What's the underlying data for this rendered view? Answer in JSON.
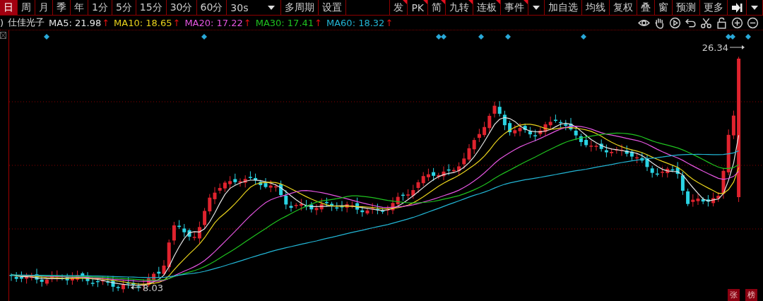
{
  "toolbar": {
    "periods": [
      {
        "label": "日",
        "selected": true
      },
      {
        "label": "周",
        "selected": false
      },
      {
        "label": "月",
        "selected": false
      },
      {
        "label": "季",
        "selected": false
      },
      {
        "label": "年",
        "selected": false
      },
      {
        "label": "1分",
        "selected": false
      },
      {
        "label": "5分",
        "selected": false
      },
      {
        "label": "15分",
        "selected": false
      },
      {
        "label": "30分",
        "selected": false
      },
      {
        "label": "60分",
        "selected": false
      },
      {
        "label": "30s",
        "selected": false,
        "kind": "dropdown"
      },
      {
        "label": "多周期",
        "selected": false
      },
      {
        "label": "设置",
        "selected": false
      }
    ],
    "tools": [
      {
        "label": "发",
        "kind": "flagged"
      },
      {
        "label": "PK",
        "kind": "flagged"
      },
      {
        "label": "简",
        "kind": "flagged"
      },
      {
        "label": "九转",
        "kind": "flagged"
      },
      {
        "label": "连板",
        "kind": "flagged"
      },
      {
        "label": "事件",
        "kind": "flagged"
      },
      {
        "kind": "dropdown"
      },
      {
        "label": "加自选",
        "kind": "plain"
      },
      {
        "label": "均线",
        "kind": "plain"
      },
      {
        "label": "复权",
        "kind": "plain"
      },
      {
        "label": "叠",
        "kind": "plain"
      },
      {
        "label": "窗",
        "kind": "plain"
      },
      {
        "label": "预测",
        "kind": "plain"
      },
      {
        "label": "更多",
        "kind": "plain"
      },
      {
        "kind": "collapse"
      },
      {
        "kind": "dropdown"
      }
    ]
  },
  "legend": {
    "prefix": ")",
    "name": "仕佳光子",
    "averages": [
      {
        "label": "MA5: 21.98",
        "arrow": "↑",
        "color": "#e6e6e6"
      },
      {
        "label": "MA10: 18.65",
        "arrow": "↑",
        "color": "#e8d21c"
      },
      {
        "label": "MA20: 17.22",
        "arrow": "↑",
        "color": "#e455e0"
      },
      {
        "label": "MA30: 17.41",
        "arrow": "↑",
        "color": "#1fc21f"
      },
      {
        "label": "MA60: 18.32",
        "arrow": "↑",
        "color": "#22b5d4"
      }
    ]
  },
  "chart": {
    "high_label": "26.34",
    "low_label": "8.03"
  },
  "badges": [
    "张",
    "榜"
  ]
}
